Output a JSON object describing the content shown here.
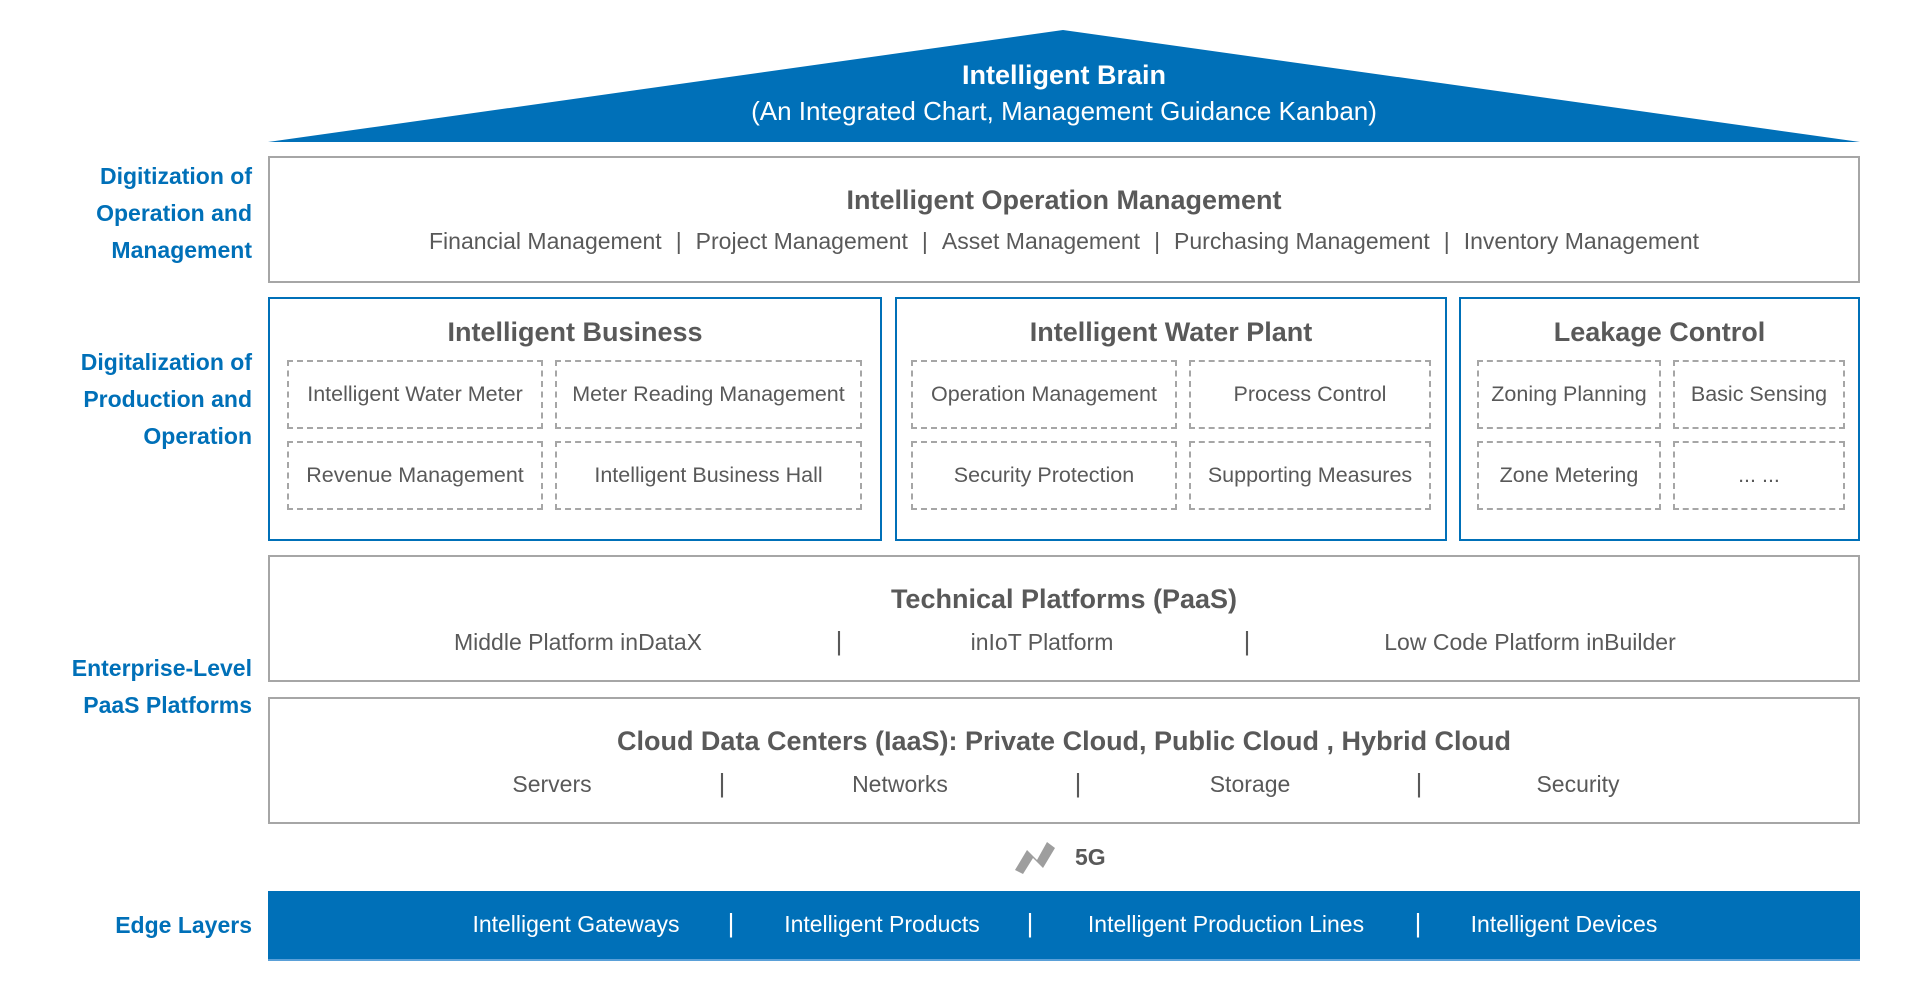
{
  "brain": {
    "title": "Intelligent Brain",
    "subtitle": "(An Integrated Chart, Management Guidance Kanban)",
    "color": "#0070b8"
  },
  "side_labels": {
    "operation_management": [
      "Digitization of",
      "Operation and",
      "Management"
    ],
    "production_operation": [
      "Digitalization of",
      "Production and",
      "Operation"
    ],
    "paas": [
      "Enterprise-Level",
      "PaaS Platforms"
    ],
    "edge": [
      "Edge Layers"
    ]
  },
  "operation_management": {
    "title": "Intelligent Operation Management",
    "items": [
      "Financial Management",
      "Project Management",
      "Asset Management",
      "Purchasing Management",
      "Inventory Management"
    ],
    "separator": "|"
  },
  "production": [
    {
      "title": "Intelligent Business",
      "cells": [
        "Intelligent Water Meter",
        "Meter Reading Management",
        "Revenue Management",
        "Intelligent Business Hall"
      ]
    },
    {
      "title": "Intelligent Water Plant",
      "cells": [
        "Operation Management",
        "Process Control",
        "Security Protection",
        "Supporting Measures"
      ]
    },
    {
      "title": "Leakage Control",
      "cells": [
        "Zoning Planning",
        "Basic Sensing",
        "Zone Metering",
        "... ..."
      ]
    }
  ],
  "paas": {
    "title": "Technical Platforms (PaaS)",
    "items": [
      "Middle Platform inDataX",
      "inIoT Platform",
      "Low Code Platform inBuilder"
    ],
    "separator": "|"
  },
  "iaas": {
    "title": "Cloud Data Centers (IaaS): Private Cloud, Public Cloud , Hybrid Cloud",
    "items": [
      "Servers",
      "Networks",
      "Storage",
      "Security"
    ],
    "separator": "|"
  },
  "network": {
    "icon": "5g-signal-icon",
    "label": "5G"
  },
  "edge": {
    "items": [
      "Intelligent Gateways",
      "Intelligent Products",
      "Intelligent Production Lines",
      "Intelligent Devices"
    ],
    "separator": "|"
  },
  "colors": {
    "accent": "#0070b8",
    "text": "#595959",
    "border": "#a6a6a6"
  }
}
